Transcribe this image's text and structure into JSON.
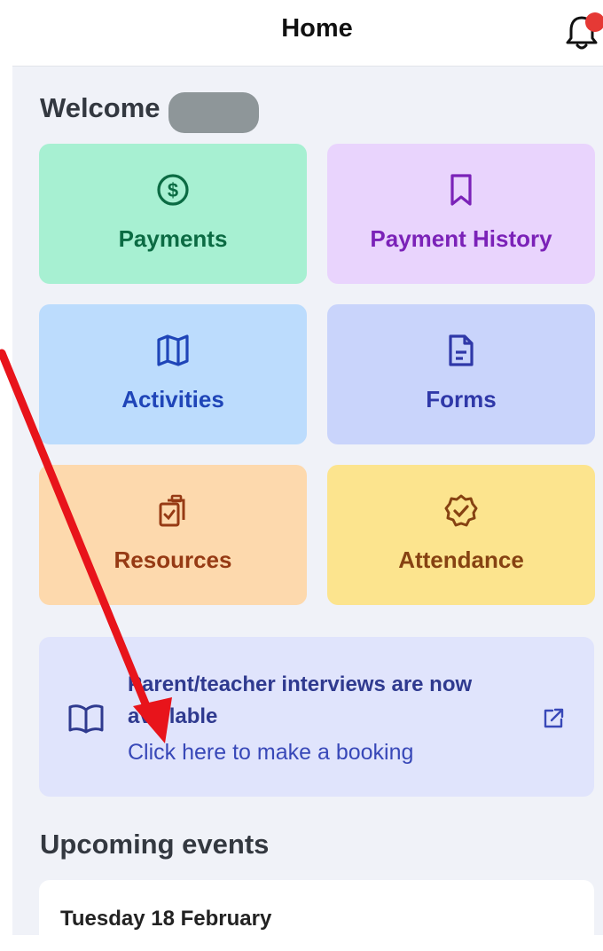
{
  "header": {
    "title": "Home",
    "bell_icon": "bell-icon",
    "badge_color": "#e53935"
  },
  "welcome": {
    "text": "Welcome"
  },
  "tiles": [
    {
      "label": "Payments",
      "icon": "dollar-circle-icon",
      "bg": "#a7f0d2",
      "color": "#0b6b43"
    },
    {
      "label": "Payment History",
      "icon": "bookmark-icon",
      "bg": "#e9d4fd",
      "color": "#7b22b8"
    },
    {
      "label": "Activities",
      "icon": "map-icon",
      "bg": "#bcdcfd",
      "color": "#1f45b8"
    },
    {
      "label": "Forms",
      "icon": "document-icon",
      "bg": "#c9d4fb",
      "color": "#2f38a8"
    },
    {
      "label": "Resources",
      "icon": "clipboard-check-icon",
      "bg": "#fdd9ad",
      "color": "#963a14"
    },
    {
      "label": "Attendance",
      "icon": "badge-check-icon",
      "bg": "#fce48e",
      "color": "#864212"
    }
  ],
  "banner": {
    "title": "Parent/teacher interviews are now available",
    "link": "Click here to make a booking",
    "icon": "book-open-icon",
    "external_icon": "external-link-icon"
  },
  "events": {
    "heading": "Upcoming events",
    "items": [
      {
        "date": "Tuesday 18 February"
      }
    ]
  },
  "annotation": {
    "arrow_color": "#e8141b"
  }
}
